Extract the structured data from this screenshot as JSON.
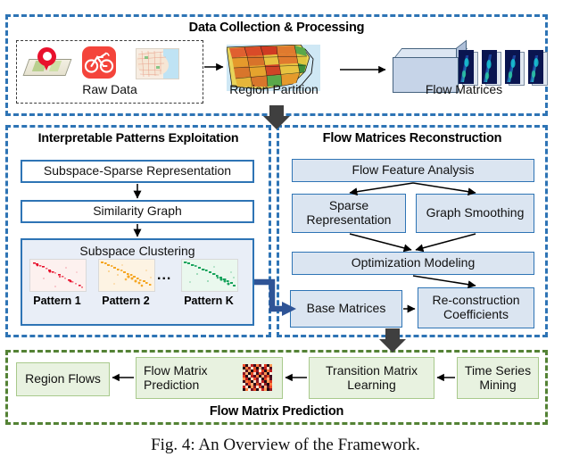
{
  "figure": {
    "caption": "Fig. 4: An Overview of the Framework."
  },
  "panels": {
    "data_collection": {
      "title": "Data Collection & Processing",
      "border_color": "#2e74b5",
      "raw_data_label": "Raw Data",
      "region_partition_label": "Region Partition",
      "flow_matrices_label": "Flow Matrices",
      "icons": [
        "map-pin-icon",
        "bike-share-icon",
        "city-map-icon"
      ]
    },
    "patterns": {
      "title": "Interpretable Patterns Exploitation",
      "border_color": "#2e74b5",
      "boxes": [
        {
          "label": "Subspace-Sparse Representation"
        },
        {
          "label": "Similarity Graph"
        },
        {
          "label": "Subspace Clustering"
        }
      ],
      "patterns": [
        {
          "label": "Pattern 1",
          "color": "#e8112d"
        },
        {
          "label": "Pattern 2",
          "color": "#f5a623"
        },
        {
          "label": "Pattern K",
          "color": "#17a35c"
        }
      ],
      "ellipsis": "..."
    },
    "reconstruction": {
      "title": "Flow Matrices Reconstruction",
      "border_color": "#2e74b5",
      "boxes": [
        {
          "label": "Flow Feature Analysis"
        },
        {
          "label": "Sparse Representation"
        },
        {
          "label": "Graph Smoothing"
        },
        {
          "label": "Optimization Modeling"
        },
        {
          "label": "Base Matrices"
        },
        {
          "label": "Re-construction Coefficients"
        }
      ]
    },
    "prediction": {
      "title": "Flow Matrix Prediction",
      "border_color": "#548235",
      "boxes": [
        {
          "label": "Region Flows"
        },
        {
          "label": "Flow Matrix Prediction"
        },
        {
          "label": "Transition Matrix Learning"
        },
        {
          "label": "Time Series Mining"
        }
      ]
    }
  },
  "connectors": {
    "block_arrow_color": "#3f3f3f",
    "thick_arrow_color": "#2f5496",
    "thin_arrow_color": "#000000"
  }
}
